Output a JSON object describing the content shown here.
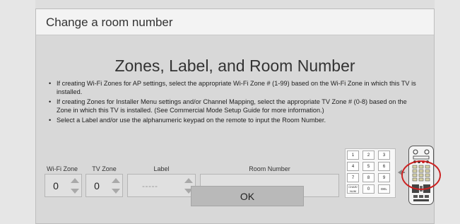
{
  "header": {
    "title": "Change a room number"
  },
  "main": {
    "heading": "Zones, Label, and Room Number",
    "bullets": [
      "If creating Wi-Fi Zones for AP settings, select the appropriate Wi-Fi Zone # (1-99) based on the Wi-Fi Zone in which this TV is installed.",
      "If creating Zones for Installer Menu settings and/or Channel Mapping, select the appropriate TV Zone # (0-8) based on the Zone in which this TV is installed. (See Commercial Mode Setup Guide for more information.)",
      "Select a Label and/or use the alphanumeric keypad on the remote to input the Room Number."
    ]
  },
  "fields": {
    "wifi_zone": {
      "label": "Wi-Fi Zone",
      "value": "0"
    },
    "tv_zone": {
      "label": "TV Zone",
      "value": "0"
    },
    "label": {
      "label": "Label",
      "value": "-----"
    },
    "room_number": {
      "label": "Room Number",
      "value": ""
    }
  },
  "keypad": {
    "keys": [
      "1",
      "2",
      "3",
      "4",
      "5",
      "6",
      "7",
      "8",
      "9",
      "CHAR/ NUM",
      "0",
      "DEL"
    ]
  },
  "buttons": {
    "ok_label": "OK"
  },
  "icons": {
    "arrow": "left-arrow-icon",
    "remote": "remote-control-icon"
  },
  "colors": {
    "highlight": "#cc2222"
  }
}
